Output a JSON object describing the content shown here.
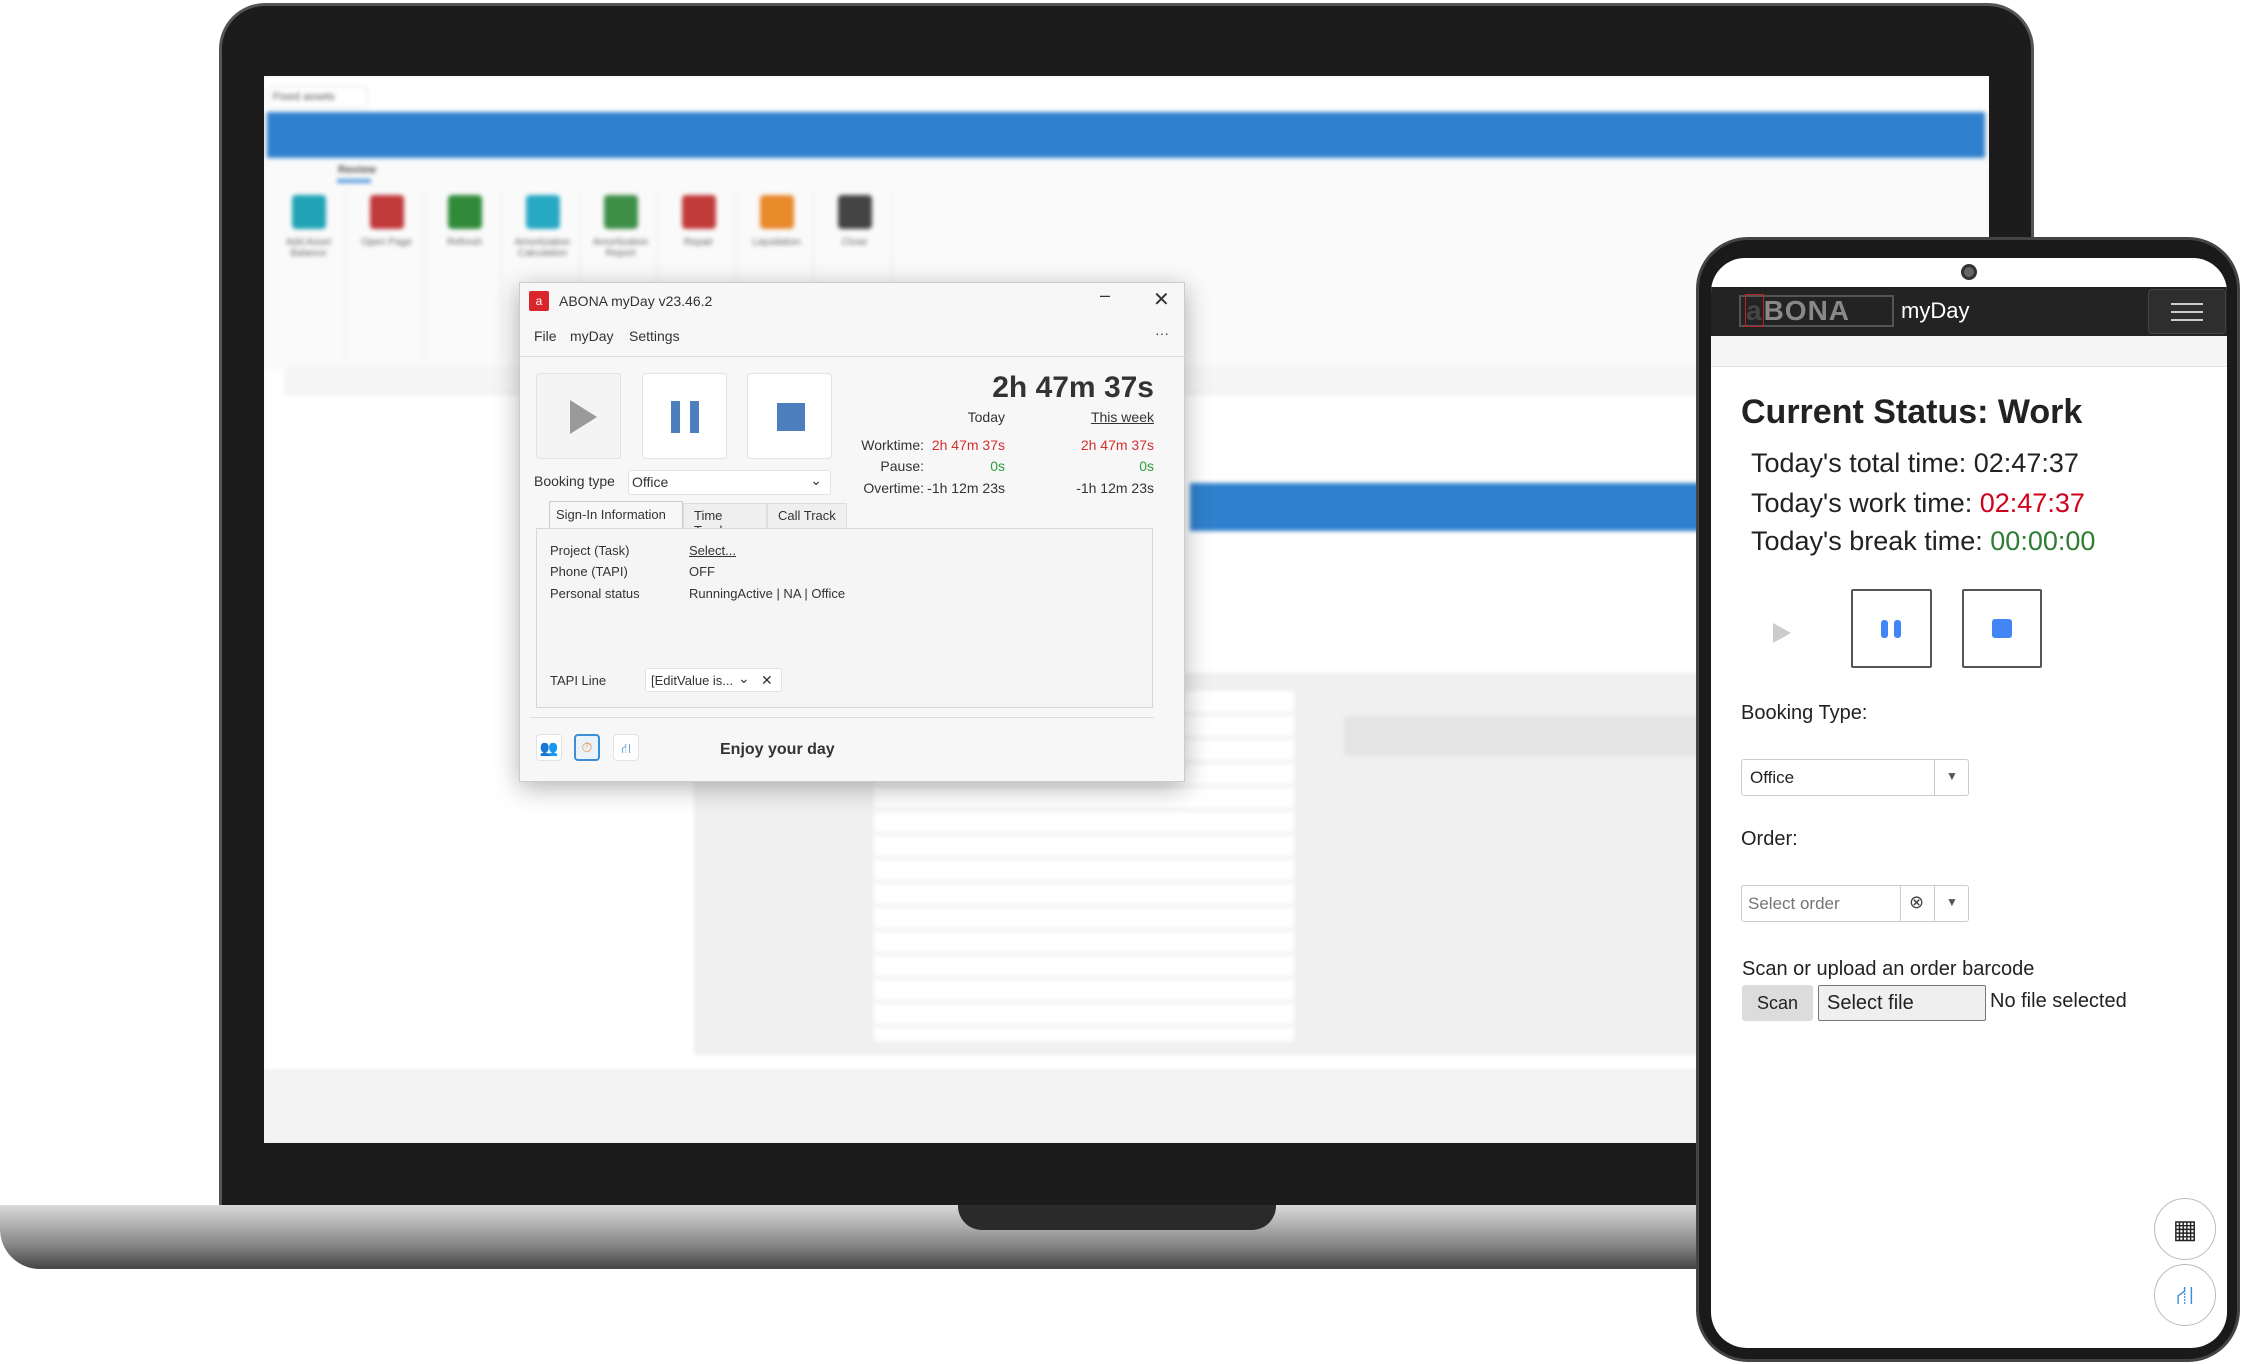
{
  "laptop_app": {
    "tab": "Fixed assets",
    "ribbon_tab": "Review",
    "toolbar": [
      {
        "label": "Add Asset Balance",
        "color": "#1fa3b5"
      },
      {
        "label": "Open Page",
        "color": "#c0393b"
      },
      {
        "label": "Refresh",
        "color": "#2f8a3a"
      },
      {
        "label": "Amortization Calculation",
        "color": "#27a8c4"
      },
      {
        "label": "Amortization Report",
        "color": "#3d8f48"
      },
      {
        "label": "Repair",
        "color": "#c23b3b"
      },
      {
        "label": "Liquidation",
        "color": "#e8892a"
      },
      {
        "label": "Close",
        "color": "#444444"
      }
    ],
    "accent": "#2f80cd"
  },
  "dialog": {
    "title": "ABONA myDay v23.46.2",
    "menu": [
      "File",
      "myDay",
      "Settings"
    ],
    "more": "···",
    "total": "2h 47m 37s",
    "col_today": "Today",
    "col_week": "This week",
    "rows": [
      {
        "label": "Worktime:",
        "today": "2h 47m 37s",
        "week": "2h 47m 37s"
      },
      {
        "label": "Pause:",
        "today": "0s",
        "week": "0s"
      },
      {
        "label": "Overtime:",
        "today": "-1h 12m 23s",
        "week": "-1h 12m 23s"
      }
    ],
    "booking_label": "Booking type",
    "booking_value": "Office",
    "tabs": [
      "Sign-In Information",
      "Time Track",
      "Call Track"
    ],
    "info": [
      {
        "label": "Project (Task)",
        "value": "Select..."
      },
      {
        "label": "Phone (TAPI)",
        "value": "OFF"
      },
      {
        "label": "Personal status",
        "value": "RunningActive | NA | Office"
      }
    ],
    "tapi_label": "TAPI Line",
    "tapi_value": "[EditValue is...",
    "footer": "Enjoy your day"
  },
  "phone": {
    "logo": "aBONA",
    "app_name": "myDay",
    "status_title": "Current Status: Work",
    "total_label": "Today's total time:",
    "total_value": "02:47:37",
    "work_label": "Today's work time:",
    "work_value": "02:47:37",
    "break_label": "Today's break time:",
    "break_value": "00:00:00",
    "booking_label": "Booking Type:",
    "booking_value": "Office",
    "order_label": "Order:",
    "order_placeholder": "Select order",
    "scan_label": "Scan or upload an order barcode",
    "scan_button": "Scan",
    "file_button": "Select file",
    "file_status": "No file selected",
    "colors": {
      "work": "#d0021b",
      "break": "#2e7d32",
      "accent": "#4285f4"
    }
  }
}
